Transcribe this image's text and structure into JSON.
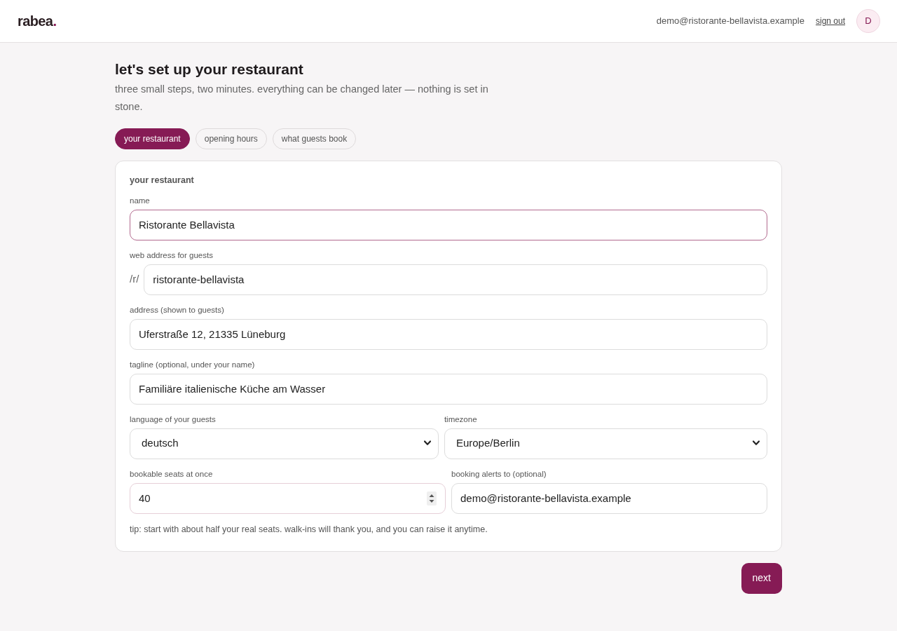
{
  "header": {
    "logo": {
      "word": "rabea",
      "dot": "."
    },
    "account_email": "demo@ristorante-bellavista.example",
    "sign_out": "sign out",
    "avatar_initial": "D"
  },
  "page": {
    "title": "let's set up your restaurant",
    "subtitle": "three small steps, two minutes. everything can be changed later — nothing is set in stone."
  },
  "steps": [
    {
      "label": "your restaurant",
      "selected": true
    },
    {
      "label": "opening hours",
      "selected": false
    },
    {
      "label": "what guests book",
      "selected": false
    }
  ],
  "form": {
    "section_title": "your restaurant",
    "rows": [
      {
        "fields": [
          {
            "kind": "text",
            "label": "name",
            "value": "Ristorante Bellavista",
            "focused": true,
            "hovered": false
          }
        ]
      },
      {
        "fields": [
          {
            "kind": "prefixed",
            "label": "web address for guests",
            "prefix": "/r/",
            "value": "ristorante-bellavista",
            "focused": false,
            "hovered": false
          }
        ]
      },
      {
        "fields": [
          {
            "kind": "text",
            "label": "address (shown to guests)",
            "value": "Uferstraße 12, 21335 Lüneburg",
            "focused": false,
            "hovered": false
          }
        ]
      },
      {
        "fields": [
          {
            "kind": "text",
            "label": "tagline (optional, under your name)",
            "value": "Familiäre italienische Küche am Wasser",
            "focused": false,
            "hovered": false
          }
        ]
      },
      {
        "fields": [
          {
            "kind": "select",
            "label": "language of your guests",
            "value": "deutsch",
            "focused": false,
            "hovered": false
          },
          {
            "kind": "select",
            "label": "timezone",
            "value": "Europe/Berlin",
            "focused": false,
            "hovered": false
          }
        ]
      },
      {
        "fields": [
          {
            "kind": "number",
            "label": "bookable seats at once",
            "value": "40",
            "focused": false,
            "hovered": true
          },
          {
            "kind": "text",
            "label": "booking alerts to (optional)",
            "value": "demo@ristorante-bellavista.example",
            "focused": false,
            "hovered": false
          }
        ]
      }
    ],
    "tip": "tip: start with about half your real seats. walk-ins will thank you, and you can raise it anytime."
  },
  "next_button": "next"
}
